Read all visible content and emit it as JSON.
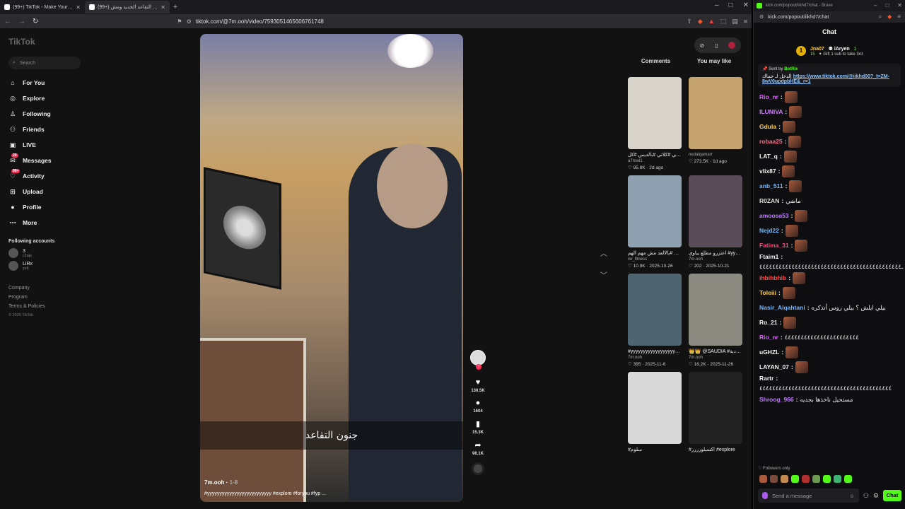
{
  "browser": {
    "tabs": [
      {
        "title": "(99+) TikTok - Make Your Day",
        "active": false
      },
      {
        "title": "(99+) نظام التقاعد الجديد ومش...",
        "active": true
      }
    ],
    "url": "tiktok.com/@7m.ooh/video/7593051465606761748"
  },
  "sidebar": {
    "logo": "TikTok",
    "search_placeholder": "Search",
    "nav": [
      {
        "label": "For You",
        "icon": "home-icon",
        "glyph": "⌂"
      },
      {
        "label": "Explore",
        "icon": "compass-icon",
        "glyph": "◎"
      },
      {
        "label": "Following",
        "icon": "following-icon",
        "glyph": "♙"
      },
      {
        "label": "Friends",
        "icon": "friends-icon",
        "glyph": "⚇"
      },
      {
        "label": "LIVE",
        "icon": "live-icon",
        "glyph": "▣"
      },
      {
        "label": "Messages",
        "icon": "messages-icon",
        "glyph": "✉",
        "badge": "29"
      },
      {
        "label": "Activity",
        "icon": "activity-icon",
        "glyph": "♡",
        "badge": "99+"
      },
      {
        "label": "Upload",
        "icon": "upload-icon",
        "glyph": "⊞"
      },
      {
        "label": "Profile",
        "icon": "profile-icon",
        "glyph": "●"
      },
      {
        "label": "More",
        "icon": "more-icon",
        "glyph": "⋯"
      }
    ],
    "following_title": "Following accounts",
    "accounts": [
      {
        "name": "3",
        "user": "c1ajs"
      },
      {
        "name": "LiRx",
        "user": "yx8"
      }
    ],
    "footer": [
      "Company",
      "Program",
      "Terms & Policies"
    ],
    "copyright": "© 2026 TikTok"
  },
  "video": {
    "caption_overlay": "جنون التقاعد",
    "author": "7m.ooh",
    "date": "1-8",
    "hashtags": "#yyyyyyyyyyyyyyyyyyyyyyyyyy #explore #foryou #fyp ..."
  },
  "actions": {
    "likes": "130.5K",
    "comments": "1604",
    "saves": "15.3K",
    "shares": "98.1K"
  },
  "right_panel": {
    "tab_comments": "Comments",
    "tab_you_may_like": "You may like",
    "cards": [
      {
        "title": "كلاتي #كلاتي #بالديس #كل #foryou #fyp",
        "user": "a7mwl1",
        "stats": "♡ 95.8K · 2d ago",
        "bg": "#d9d4cb"
      },
      {
        "title": "",
        "user": "nedalqamarr",
        "stats": "♡ 273.5K · 1d ago",
        "bg": "#c5a46f"
      },
      {
        "title": "هكي روين هرو بالإلبات #بالالعد مش مهم الهم",
        "user": "rw_fitness",
        "stats": "♡ 10.9K · 2025-10-26",
        "bg": "#8fa0b0"
      },
      {
        "title": "اعتزرو مطلع يباوي #yyyyyyyyyyyy...",
        "user": "7m.ooh",
        "stats": "♡ 202 · 2025-10-21",
        "bg": "#5a4c58"
      },
      {
        "title": "#yyyyyyyyyyyyyyyyyyyyyyyy...",
        "user": "7m.ooh",
        "stats": "♡ 395 · 2025-11-6",
        "bg": "#4e6470"
      },
      {
        "title": "👑👑 @SAUDIA #السعودية #explo...",
        "user": "7m.ooh",
        "stats": "♡ 16.2K · 2025-11-26",
        "bg": "#8a8a80"
      },
      {
        "title": "#سلوم",
        "user": "",
        "stats": "",
        "bg": "#d9d9d9"
      },
      {
        "title": "#اكسبلورررر #explore",
        "user": "",
        "stats": "",
        "bg": "#222"
      }
    ]
  },
  "kick": {
    "window_url_short": "kick.com/popout/iikhd7/chat - Brave",
    "url": "kick.com/popout/iikhd7/chat",
    "header": "Chat",
    "leaderboard": {
      "name1": "Jna07",
      "count1": "15",
      "name2": "iAryen",
      "count2": "1",
      "sub": "Gift 1 sub to take 3rd"
    },
    "pinned": {
      "sent_by": "Sent by",
      "bot": "BotRix",
      "text": "إلدخل لـ حماك",
      "link": "https://www.tiktok.com/@iikhd00?_t=ZM-8wV0updpbHE&_r=1"
    },
    "messages": [
      {
        "user": "Rio_nr",
        "color": "#e05fff",
        "text": ""
      },
      {
        "user": "ILUNIVA",
        "color": "#d37cff",
        "text": ""
      },
      {
        "user": "Gdula",
        "color": "#ffd34e",
        "text": ""
      },
      {
        "user": "robaa25",
        "color": "#ff6b8a",
        "text": ""
      },
      {
        "user": "LAT_q",
        "color": "#f4f4f4",
        "text": ""
      },
      {
        "user": "vlix87",
        "color": "#f4f4f4",
        "text": ""
      },
      {
        "user": "anb_511",
        "color": "#6fb6ff",
        "text": ""
      },
      {
        "user": "R0ZAN",
        "color": "#dcdcdc",
        "text": "ماضي"
      },
      {
        "user": "amoosa53",
        "color": "#c07cff",
        "text": ""
      },
      {
        "user": "Nejd22",
        "color": "#6fb6ff",
        "text": ""
      },
      {
        "user": "Fatima_31",
        "color": "#ff4a7d",
        "text": ""
      },
      {
        "user": "Ftaim1",
        "color": "#f4f4f4",
        "text": "ـ٤٤٤٤٤٤٤٤٤٤٤٤٤٤٤٤٤٤٤٤٤٤٤٤٤٤٤٤٤٤٤٤٤٤٤٤٤٤٤٤٤٤٤٤"
      },
      {
        "user": "ihbihbhib",
        "color": "#ff4a4a",
        "text": ""
      },
      {
        "user": "Toleiii",
        "color": "#ffd34e",
        "text": ""
      },
      {
        "user": "Nasir_Alqahtani",
        "color": "#6fb6ff",
        "text": "بيلي ايلش ؟ بيلي روس أتذكره"
      },
      {
        "user": "Ro_21",
        "color": "#f4f4f4",
        "text": ""
      },
      {
        "user": "Rio_nr",
        "color": "#e05fff",
        "text": "٤٤٤٤٤٤٤٤٤٤٤٤٤٤٤٤٤٤٤٤٤٤٤"
      },
      {
        "user": "uGHZL",
        "color": "#f4f4f4",
        "text": ""
      },
      {
        "user": "LAYAN_07",
        "color": "#f4f4f4",
        "text": ""
      },
      {
        "user": "Rartr",
        "color": "#f4f4f4",
        "text": "٤٤٤٤٤٤٤٤٤٤٤٤٤٤٤٤٤٤٤٤٤٤٤٤٤٤٤٤٤٤٤٤٤٤٤٤٤٤٤٤٤"
      },
      {
        "user": "Shroog_966",
        "color": "#c07cff",
        "text": "مستحيل ناخذها بجديه"
      }
    ],
    "followers_only": "♡ Followers only",
    "input_placeholder": "Send a message",
    "send_label": "Chat"
  }
}
